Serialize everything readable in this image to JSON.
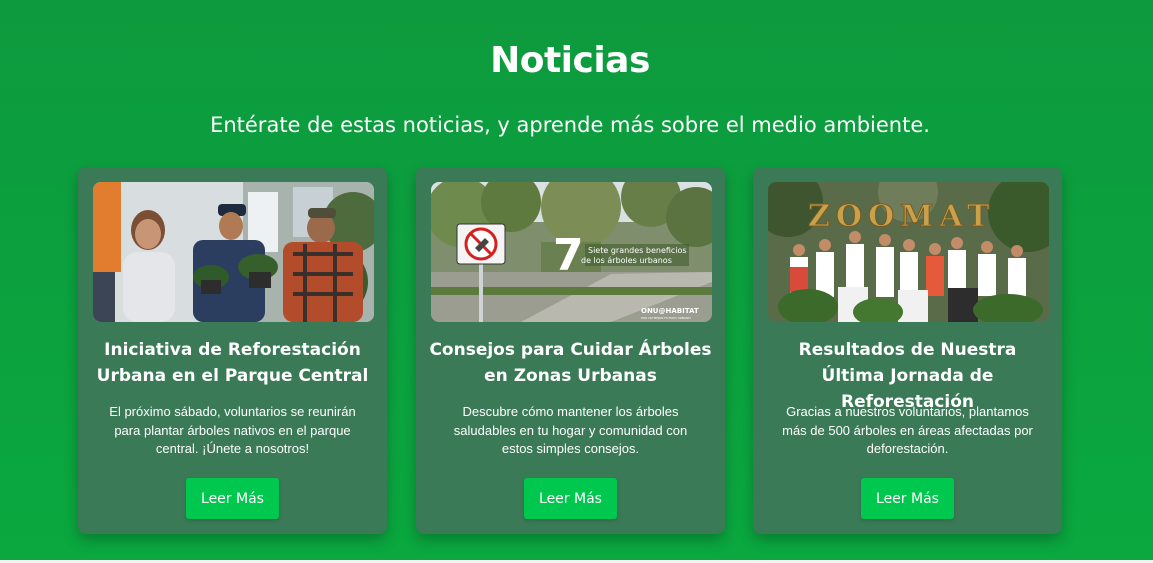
{
  "section": {
    "title": "Noticias",
    "subtitle": "Entérate de estas noticias, y aprende más sobre el medio ambiente."
  },
  "cards": [
    {
      "title": "Iniciativa de Reforestación Urbana en el Parque Central",
      "text": "El próximo sábado, voluntarios se reunirán para plantar árboles nativos en el parque central. ¡Únete a nosotros!",
      "button_label": "Leer Más",
      "image_alt": "Voluntarios con plantas"
    },
    {
      "title": "Consejos para Cuidar Árboles en Zonas Urbanas",
      "text": "Descubre cómo mantener los árboles saludables en tu hogar y comunidad con estos simples consejos.",
      "button_label": "Leer Más",
      "image_alt": "Avenida arbolada",
      "image_overlay": {
        "number": "7",
        "caption_line1": "Siete grandes beneficios",
        "caption_line2": "de los árboles urbanos",
        "brand": "ONU@HABITAT",
        "brand_sub": "POR UN MEJOR FUTURO URBANO"
      }
    },
    {
      "title": "Resultados de Nuestra Última Jornada de Reforestación",
      "text": "Gracias a nuestros voluntarios, plantamos más de 500 árboles en áreas afectadas por deforestación.",
      "button_label": "Leer Más",
      "image_alt": "Grupo en Zoomat",
      "image_sign": "ZOOMAT"
    }
  ],
  "colors": {
    "background": "#0d9a3e",
    "card": "#3b7a57",
    "button": "#00c84f"
  }
}
